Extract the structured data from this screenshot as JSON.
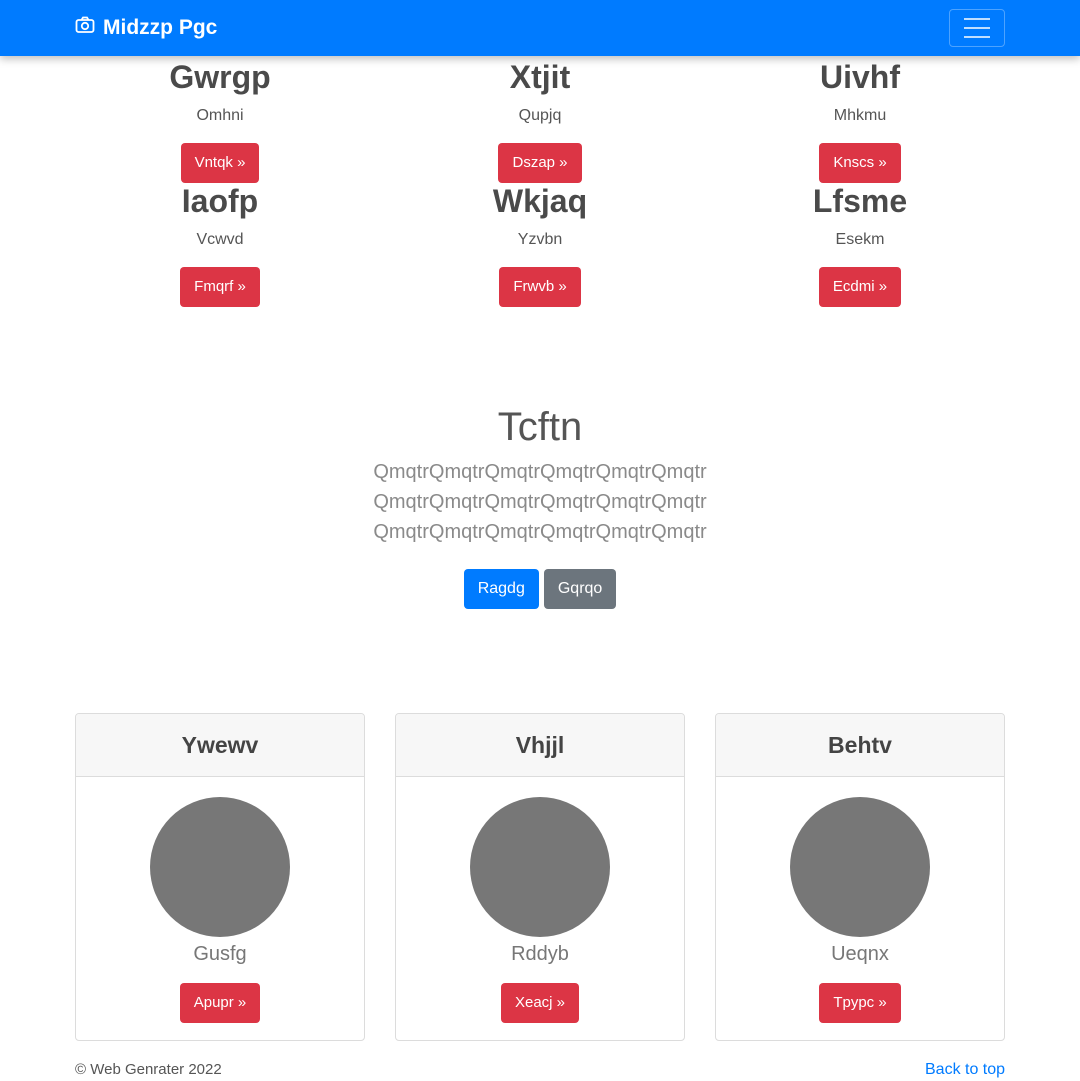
{
  "navbar": {
    "brand": "Midzzp Pgc",
    "brand_icon": "camera-icon",
    "toggler_icon": "hamburger-menu-icon",
    "color": "#007bff"
  },
  "features": [
    {
      "title": "Gwrgp",
      "subtitle": "Omhni",
      "button": "Vntqk »"
    },
    {
      "title": "Xtjit",
      "subtitle": "Qupjq",
      "button": "Dszap »"
    },
    {
      "title": "Uivhf",
      "subtitle": "Mhkmu",
      "button": "Knscs »"
    },
    {
      "title": "Iaofp",
      "subtitle": "Vcwvd",
      "button": "Fmqrf »"
    },
    {
      "title": "Wkjaq",
      "subtitle": "Yzvbn",
      "button": "Frwvb »"
    },
    {
      "title": "Lfsme",
      "subtitle": "Esekm",
      "button": "Ecdmi »"
    }
  ],
  "hero": {
    "title": "Tcftn",
    "lines": [
      "QmqtrQmqtrQmqtrQmqtrQmqtrQmqtr",
      "QmqtrQmqtrQmqtrQmqtrQmqtrQmqtr",
      "QmqtrQmqtrQmqtrQmqtrQmqtrQmqtr"
    ],
    "primary_button": "Ragdg",
    "secondary_button": "Gqrqo"
  },
  "cards": [
    {
      "header": "Ywewv",
      "name": "Gusfg",
      "button": "Apupr »"
    },
    {
      "header": "Vhjjl",
      "name": "Rddyb",
      "button": "Xeacj »"
    },
    {
      "header": "Behtv",
      "name": "Ueqnx",
      "button": "Tpypc »"
    }
  ],
  "footer": {
    "copyright": "© Web Genrater 2022",
    "back_to_top": "Back to top"
  },
  "colors": {
    "primary": "#007bff",
    "danger": "#dc3545",
    "secondary": "#6c757d"
  }
}
